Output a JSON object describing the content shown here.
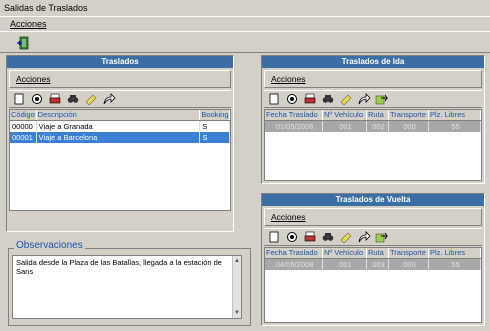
{
  "window": {
    "title": "Salidas de Traslados"
  },
  "menu": {
    "acciones": "Acciones"
  },
  "traslados": {
    "header": "Traslados",
    "acciones": "Acciones",
    "columns": [
      "Código",
      "Descripción",
      "Booking"
    ],
    "rows": [
      [
        "00000",
        "Viaje a Granada",
        "S"
      ],
      [
        "00001",
        "Viaje a Barcelona",
        "S"
      ]
    ]
  },
  "ida": {
    "header": "Traslados de Ida",
    "acciones": "Acciones",
    "columns": [
      "Fecha Traslado",
      "Nº Vehículo",
      "Ruta",
      "Transporte",
      "Plz. Libres"
    ],
    "row": [
      "01/05/2008",
      "001",
      "002",
      "000",
      "55"
    ]
  },
  "vuelta": {
    "header": "Traslados de Vuelta",
    "acciones": "Acciones",
    "columns": [
      "Fecha Traslado",
      "Nº Vehículo",
      "Ruta",
      "Transporte",
      "Plz. Libres"
    ],
    "row": [
      "04/05/2008",
      "001",
      "003",
      "000",
      "55"
    ]
  },
  "observaciones": {
    "title": "Observaciones",
    "text": "Salida desde la Plaza de las Batallas, llegada a la estación de Sans"
  },
  "icons": [
    "new-icon",
    "view-icon",
    "print-icon",
    "search-icon",
    "edit-icon",
    "forward-icon",
    "transfer-icon",
    "exit-icon"
  ]
}
